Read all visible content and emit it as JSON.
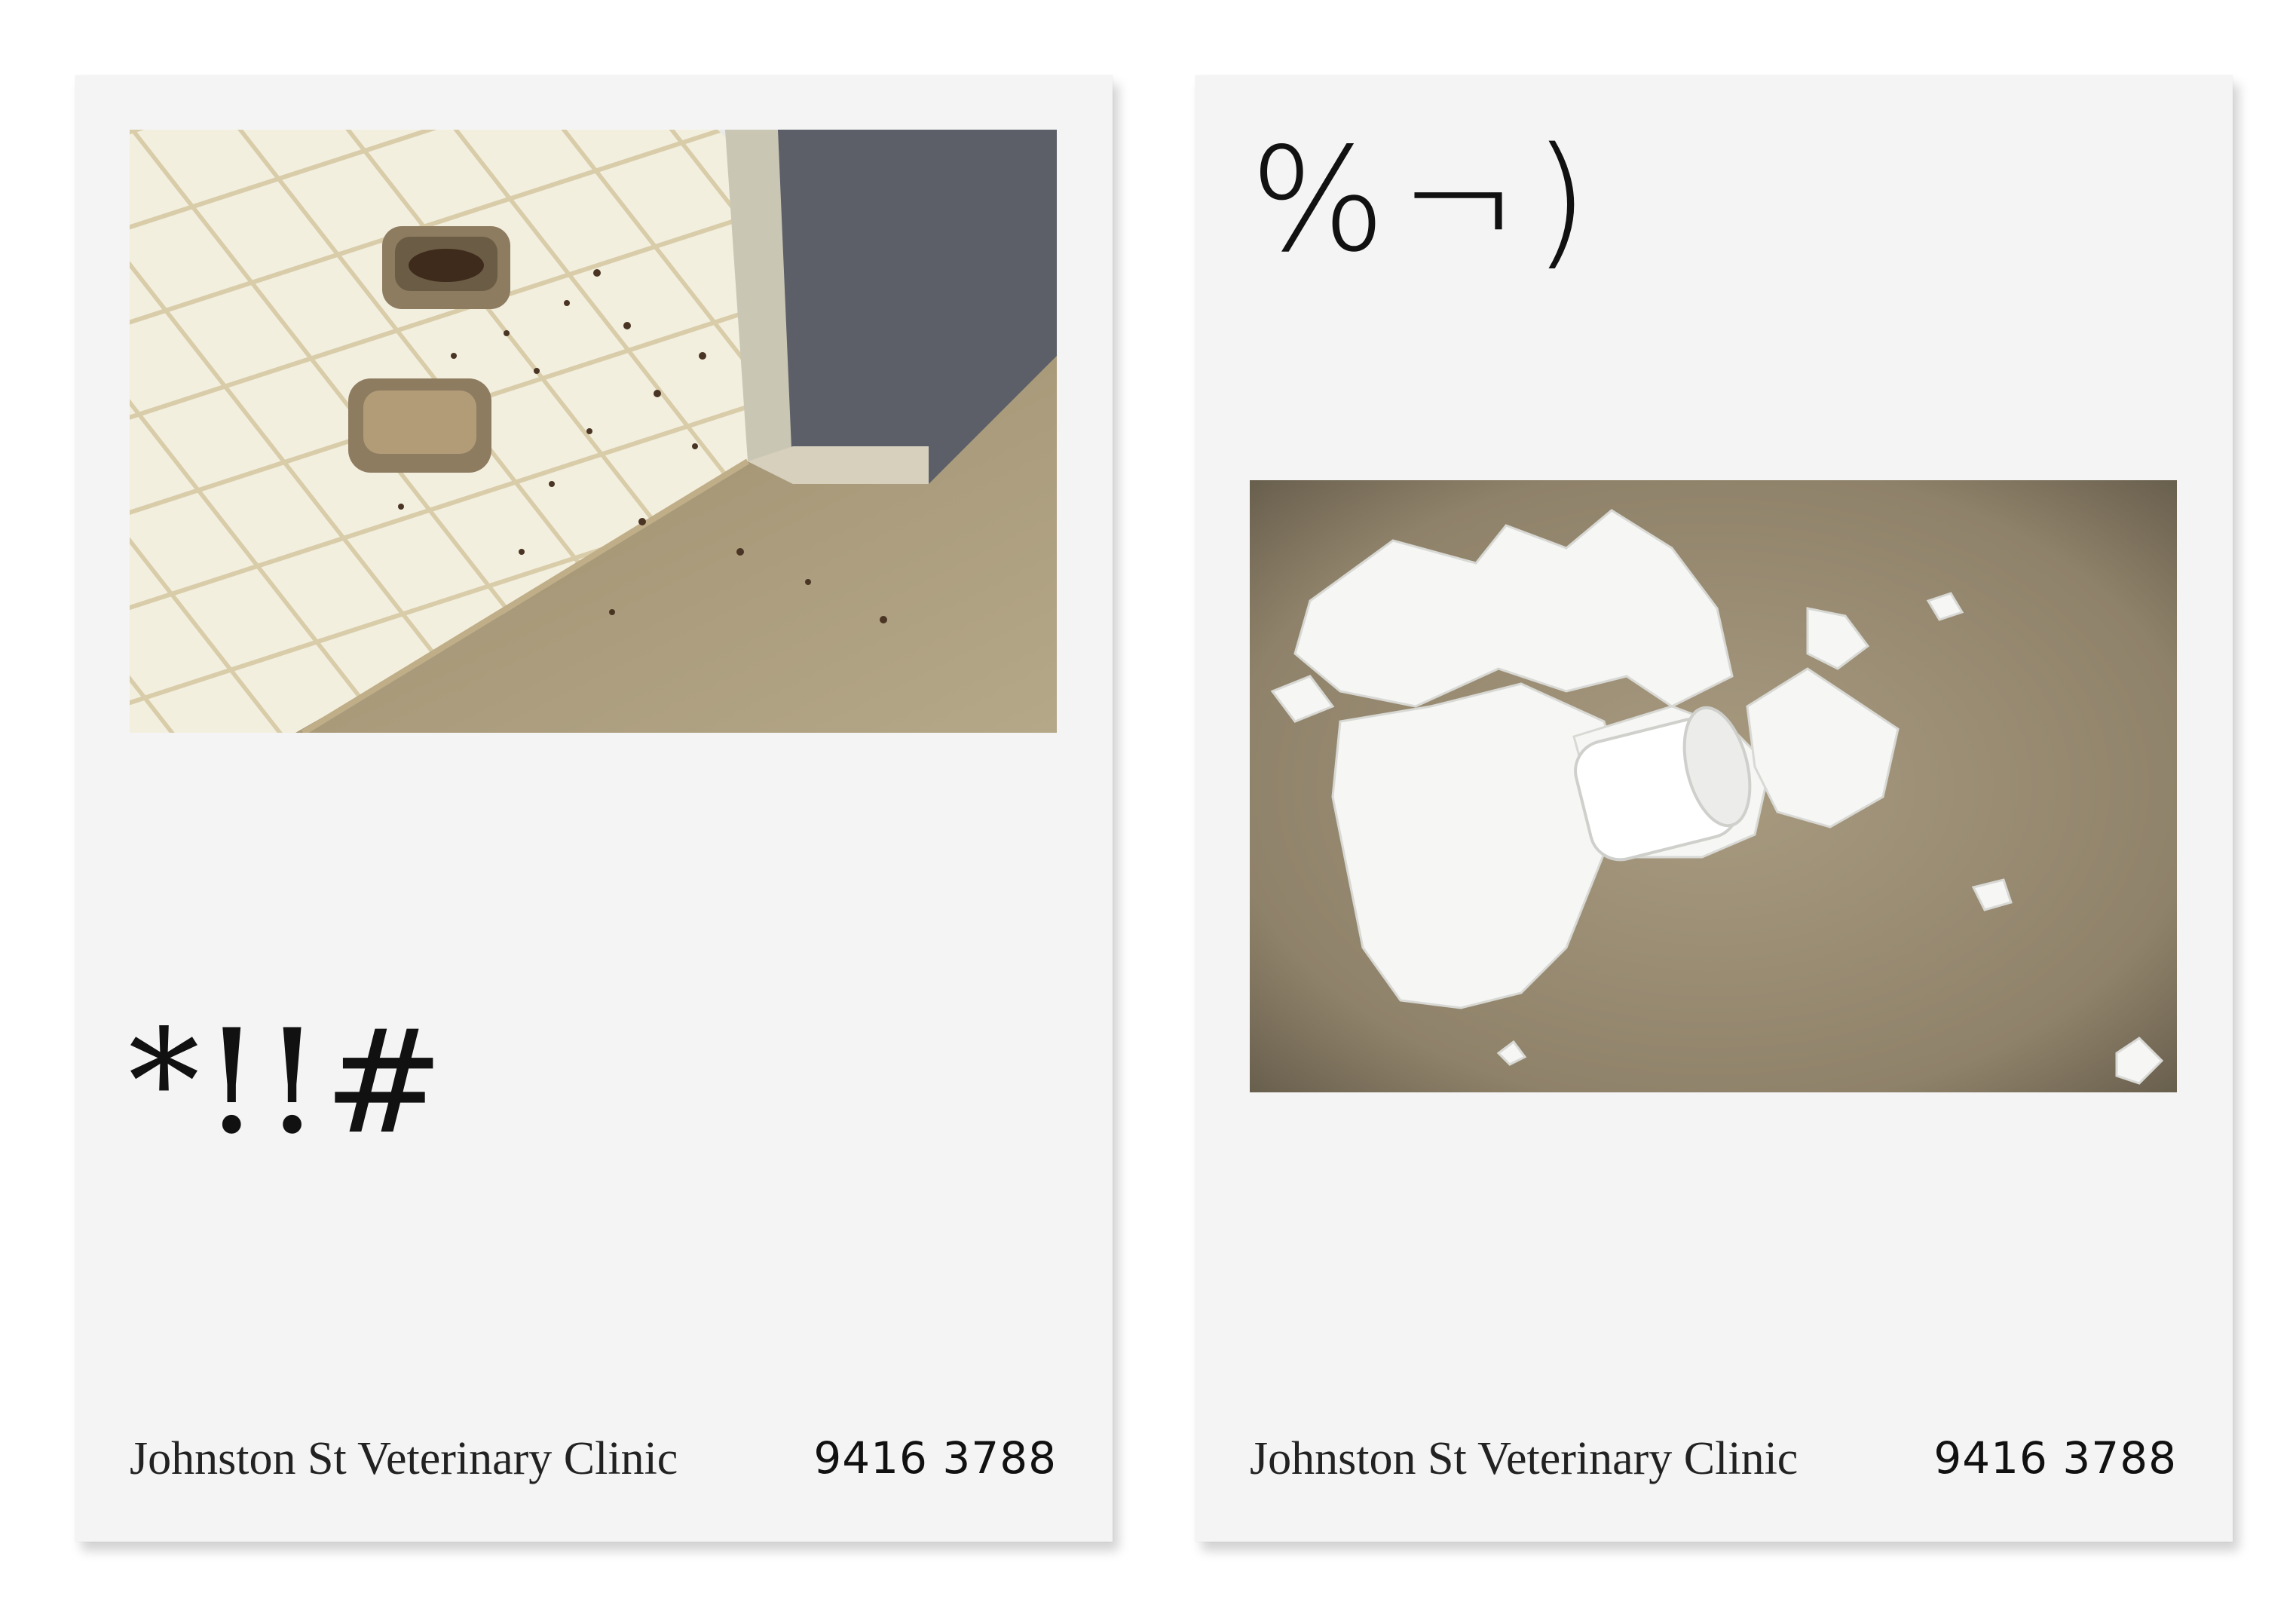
{
  "left_card": {
    "symbols": "*!!#",
    "photo_subject": "pet-food-bowls-on-tile-floor",
    "clinic_name": "Johnston St Veterinary Clinic",
    "phone": "9416 3788"
  },
  "right_card": {
    "symbols": "%¬)",
    "photo_subject": "shredded-toilet-paper-on-carpet",
    "clinic_name": "Johnston St Veterinary Clinic",
    "phone": "9416 3788"
  },
  "colors": {
    "card": "#f4f4f4",
    "tile": "#f1eddc",
    "grout": "#d9ceb0",
    "carpet": "#a39577",
    "bowl": "#8e7c61",
    "paper": "#f7f7f5"
  }
}
